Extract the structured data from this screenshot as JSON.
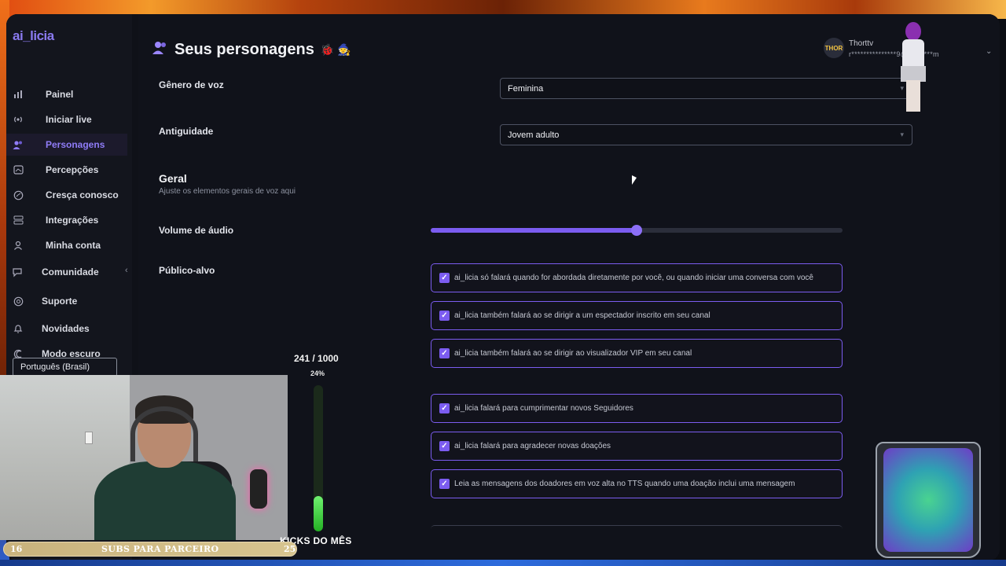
{
  "app": {
    "logo": "ai_licia",
    "title": "Seus personagens",
    "title_emojis": "🐞 🧙"
  },
  "sidebar": {
    "items": [
      {
        "label": "Painel",
        "icon": "bar-chart-icon"
      },
      {
        "label": "Iniciar live",
        "icon": "broadcast-icon"
      },
      {
        "label": "Personagens",
        "icon": "characters-icon"
      },
      {
        "label": "Percepções",
        "icon": "perception-icon"
      },
      {
        "label": "Cresça conosco",
        "icon": "growth-icon"
      },
      {
        "label": "Integrações",
        "icon": "integrations-icon"
      },
      {
        "label": "Minha conta",
        "icon": "user-icon"
      },
      {
        "label": "Comunidade",
        "icon": "community-icon"
      },
      {
        "label": "Suporte",
        "icon": "support-icon"
      },
      {
        "label": "Novidades",
        "icon": "bell-icon"
      },
      {
        "label": "Modo escuro",
        "icon": "moon-icon"
      }
    ],
    "language": "Português (Brasil)"
  },
  "user": {
    "avatar_text": "THOR",
    "name": "Thorttv",
    "email": "r***************9@g*******m"
  },
  "form": {
    "voice_gender_label": "Gênero de voz",
    "voice_gender_value": "Feminina",
    "age_label": "Antiguidade",
    "age_value": "Jovem adulto",
    "section_title": "Geral",
    "section_subtitle": "Ajuste os elementos gerais de voz aqui",
    "volume_label": "Volume de áudio",
    "volume_value": 0.5,
    "audience_label": "Público-alvo",
    "checkboxes": [
      "ai_licia só falará quando for abordada diretamente por você, ou quando iniciar uma conversa com você",
      "ai_licia também falará ao se dirigir a um espectador inscrito em seu canal",
      "ai_licia também falará ao se dirigir ao visualizador VIP em seu canal",
      "ai_licia falará para cumprimentar novos Seguidores",
      "ai_licia falará para agradecer novas doações",
      "Leia as mensagens dos doadores em voz alta no TTS quando uma doação inclui uma mensagem"
    ]
  },
  "overlay": {
    "goal_count": "241 / 1000",
    "goal_pct": "24%",
    "goal_fraction": 0.24,
    "kicks_label": "KICKS DO MÊS",
    "subs_left": "16",
    "subs_label": "SUBS PARA PARCEIRO",
    "subs_right": "25"
  },
  "colors": {
    "accent": "#7b5cf0",
    "background": "#10121a",
    "sidebar": "#13151d"
  }
}
